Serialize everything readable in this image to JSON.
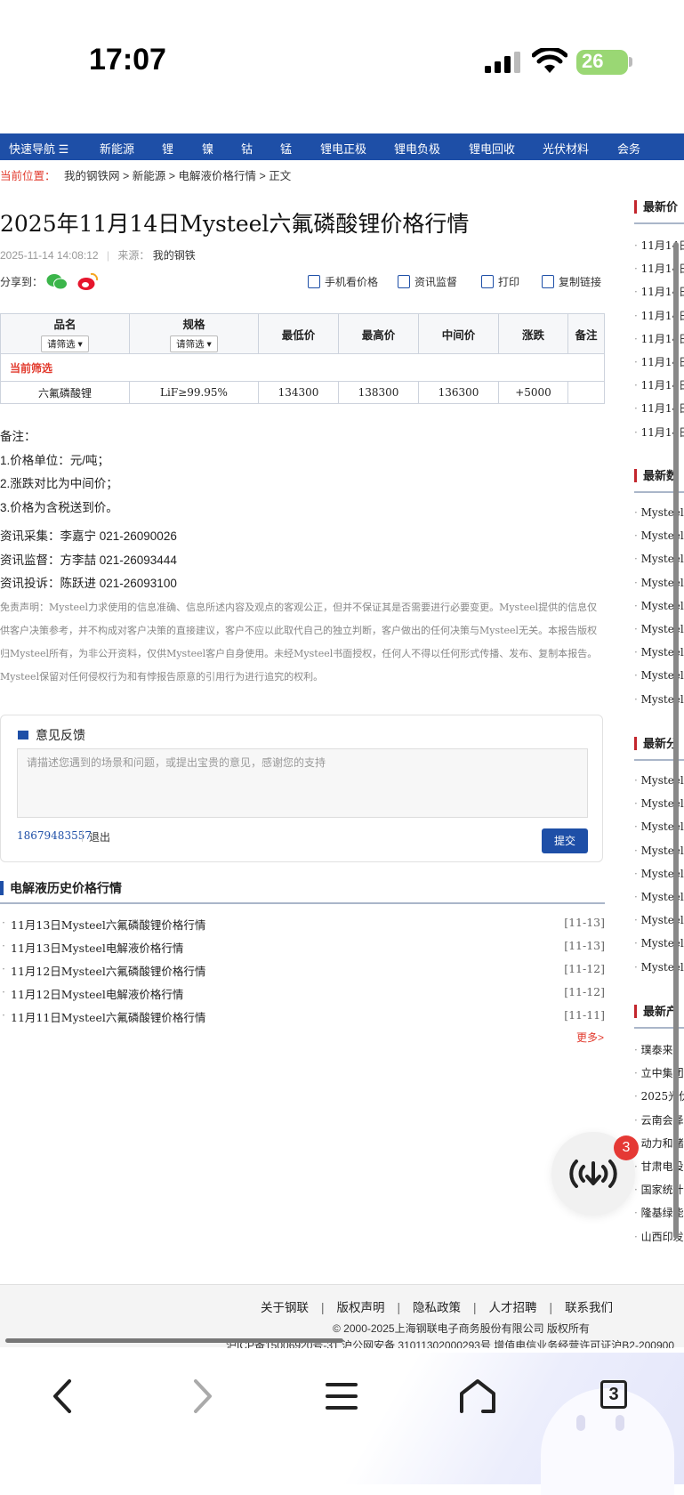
{
  "status_bar": {
    "time": "17:07",
    "battery": "26"
  },
  "nav": {
    "quick_nav": "快速导航",
    "items": [
      "新能源",
      "锂",
      "镍",
      "钴",
      "锰",
      "锂电正极",
      "锂电负极",
      "锂电回收",
      "光伏材料",
      "会务"
    ]
  },
  "breadcrumb": {
    "label": "当前位置：",
    "items": [
      "我的钢铁网",
      "新能源",
      "电解液价格行情",
      "正文"
    ]
  },
  "article": {
    "title": "2025年11月14日Mysteel六氟磷酸锂价格行情",
    "date": "2025-11-14 14:08:12",
    "source_label": "来源：",
    "source": "我的钢铁",
    "share_label": "分享到："
  },
  "tools": {
    "mobile": "手机看价格",
    "supervise": "资讯监督",
    "print": "打印",
    "copy": "复制链接"
  },
  "table": {
    "headers": [
      "品名",
      "规格",
      "最低价",
      "最高价",
      "中间价",
      "涨跌",
      "备注"
    ],
    "filter_label": "请筛选",
    "current_filter": "当前筛选",
    "rows": [
      {
        "name": "六氟磷酸锂",
        "spec": "LiF≥99.95%",
        "low": "134300",
        "high": "138300",
        "mid": "136300",
        "change": "+5000",
        "note": ""
      }
    ]
  },
  "notes": {
    "heading": "备注：",
    "lines": [
      "1.价格单位：元/吨；",
      "2.涨跌对比为中间价；",
      "3.价格为含税送到价。"
    ]
  },
  "contacts": [
    "资讯采集：李嘉宁 021-26090026",
    "资讯监督：方李喆 021-26093444",
    "资讯投诉：陈跃进 021-26093100"
  ],
  "disclaimer": "免责声明：Mysteel力求使用的信息准确、信息所述内容及观点的客观公正，但并不保证其是否需要进行必要变更。Mysteel提供的信息仅供客户决策参考，并不构成对客户决策的直接建议，客户不应以此取代自己的独立判断，客户做出的任何决策与Mysteel无关。本报告版权归Mysteel所有，为非公开资料，仅供Mysteel客户自身使用。未经Mysteel书面授权，任何人不得以任何形式传播、发布、复制本报告。Mysteel保留对任何侵权行为和有悖报告原意的引用行为进行追究的权利。",
  "feedback": {
    "title": "意见反馈",
    "placeholder": "请描述您遇到的场景和问题，或提出宝贵的意见，感谢您的支持",
    "phone": "18679483557",
    "logout": "退出",
    "submit": "提交"
  },
  "history": {
    "title": "电解液历史价格行情",
    "items": [
      {
        "title": "11月13日Mysteel六氟磷酸锂价格行情",
        "date": "[11-13]"
      },
      {
        "title": "11月13日Mysteel电解液价格行情",
        "date": "[11-13]"
      },
      {
        "title": "11月12日Mysteel六氟磷酸锂价格行情",
        "date": "[11-12]"
      },
      {
        "title": "11月12日Mysteel电解液价格行情",
        "date": "[11-12]"
      },
      {
        "title": "11月11日Mysteel六氟磷酸锂价格行情",
        "date": "[11-11]"
      }
    ],
    "more": "更多>"
  },
  "sidebar": {
    "sections": [
      {
        "title": "最新价",
        "items": [
          "11月14日",
          "11月14日",
          "11月14日",
          "11月14日",
          "11月14日",
          "11月14日",
          "11月14日",
          "11月14日",
          "11月14日"
        ]
      },
      {
        "title": "最新数",
        "items": [
          "Mysteel",
          "Mysteel",
          "Mysteel",
          "Mysteel",
          "Mysteel",
          "Mysteel",
          "Mysteel",
          "Mysteel",
          "Mysteel"
        ]
      },
      {
        "title": "最新分",
        "items": [
          "Mysteel",
          "Mysteel",
          "Mysteel",
          "Mysteel",
          "Mysteel",
          "Mysteel",
          "Mysteel",
          "Mysteel",
          "Mysteel"
        ]
      },
      {
        "title": "最新产",
        "items": [
          "璞泰来：",
          "立中集团",
          "2025光伏",
          "云南会泽",
          "动力和储",
          "甘肃电投",
          "国家统计",
          "隆基绿能",
          "山西印发"
        ]
      }
    ]
  },
  "floating": {
    "badge": "3"
  },
  "footer": {
    "links": [
      "关于钢联",
      "版权声明",
      "隐私政策",
      "人才招聘",
      "联系我们"
    ],
    "copyright": "© 2000-2025上海钢联电子商务股份有限公司 版权所有",
    "icp": "沪ICP备15006920号-31  沪公网安备 31011302000293号  增值电信业务经营许可证沪B2-200900"
  },
  "browser": {
    "tab_count": "3"
  }
}
